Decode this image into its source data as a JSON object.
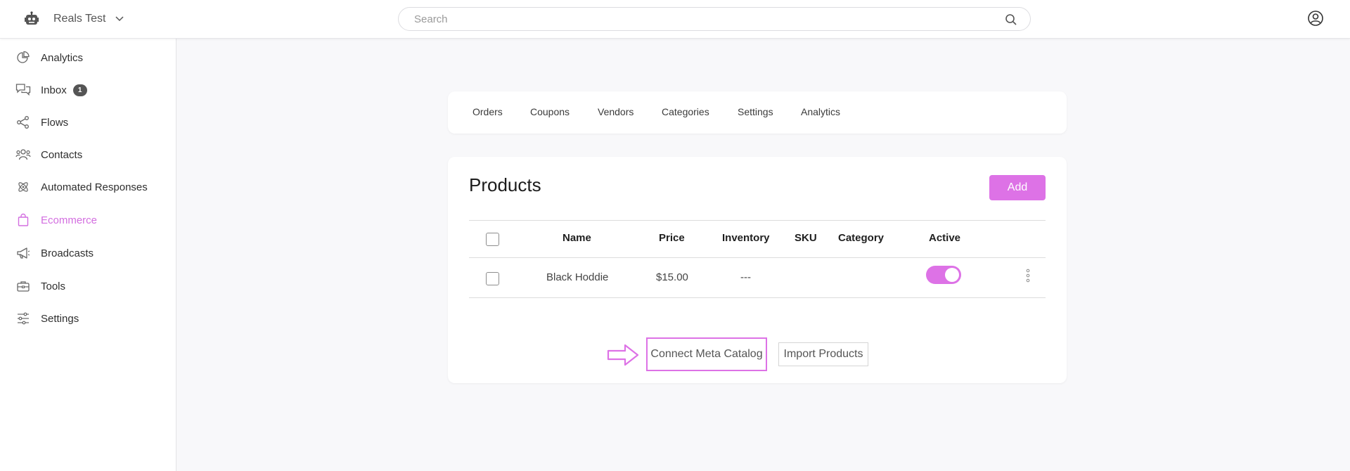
{
  "header": {
    "workspace_name": "Reals Test",
    "search_placeholder": "Search"
  },
  "sidebar": {
    "items": [
      {
        "label": "Analytics",
        "icon": "pie-chart-icon"
      },
      {
        "label": "Inbox",
        "icon": "chat-bubbles-icon",
        "badge": "1"
      },
      {
        "label": "Flows",
        "icon": "flow-icon"
      },
      {
        "label": "Contacts",
        "icon": "people-icon"
      },
      {
        "label": "Automated Responses",
        "icon": "atom-icon"
      },
      {
        "label": "Ecommerce",
        "icon": "shopping-bag-icon",
        "active": true
      },
      {
        "label": "Broadcasts",
        "icon": "megaphone-icon"
      },
      {
        "label": "Tools",
        "icon": "toolbox-icon"
      },
      {
        "label": "Settings",
        "icon": "sliders-icon"
      }
    ]
  },
  "tabs": [
    "Orders",
    "Coupons",
    "Vendors",
    "Categories",
    "Settings",
    "Analytics"
  ],
  "products": {
    "title": "Products",
    "add_label": "Add",
    "columns": [
      "Name",
      "Price",
      "Inventory",
      "SKU",
      "Category",
      "Active"
    ],
    "rows": [
      {
        "name": "Black Hoddie",
        "price": "$15.00",
        "inventory": "---",
        "sku": "",
        "category": "",
        "active": true
      }
    ],
    "connect_label": "Connect Meta Catalog",
    "import_label": "Import Products"
  },
  "colors": {
    "accent": "#dd72e6",
    "active_nav": "#d36ee0",
    "badge": "#555555"
  }
}
